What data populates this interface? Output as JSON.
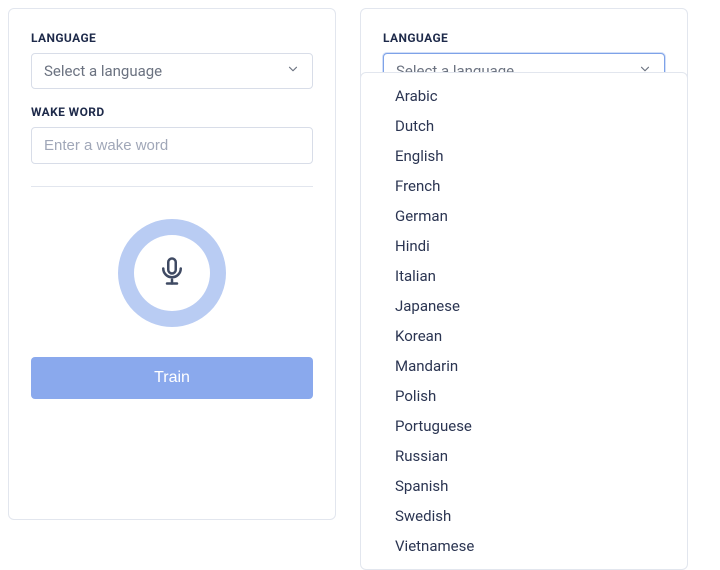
{
  "colors": {
    "accent": "#8aa9ed",
    "ring": "#b9ccf3",
    "text": "#1e2a4a",
    "border": "#e2e6ee"
  },
  "left": {
    "language_label": "LANGUAGE",
    "select_placeholder": "Select a language",
    "wakeword_label": "WAKE WORD",
    "input_placeholder": "Enter a wake word",
    "mic_icon": "microphone-icon",
    "train_button": "Train"
  },
  "right": {
    "language_label": "LANGUAGE",
    "select_placeholder": "Select a language",
    "options": [
      "Arabic",
      "Dutch",
      "English",
      "French",
      "German",
      "Hindi",
      "Italian",
      "Japanese",
      "Korean",
      "Mandarin",
      "Polish",
      "Portuguese",
      "Russian",
      "Spanish",
      "Swedish",
      "Vietnamese"
    ]
  }
}
